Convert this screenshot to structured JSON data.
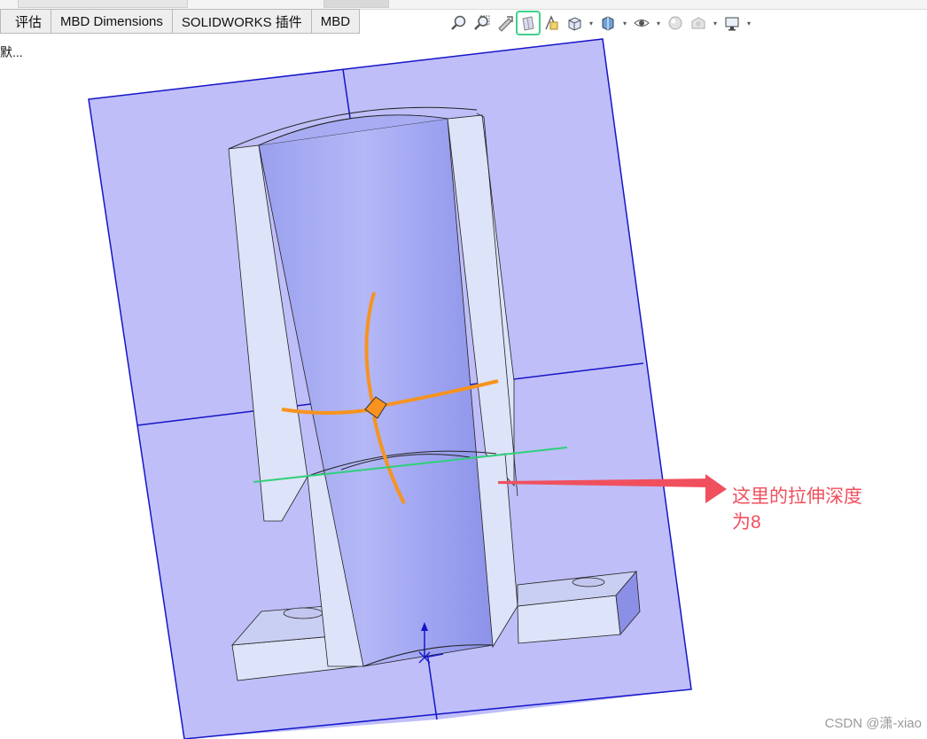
{
  "tabs": [
    {
      "label": "评估"
    },
    {
      "label": "MBD Dimensions"
    },
    {
      "label": "SOLIDWORKS 插件"
    },
    {
      "label": "MBD"
    }
  ],
  "view_toolbar": {
    "icons": [
      "zoom-to-fit-icon",
      "zoom-to-area-icon",
      "previous-view-icon",
      "section-view-icon",
      "dynamic-annotation-icon",
      "view-orientation-icon",
      "display-style-icon",
      "hide-show-items-icon",
      "edit-appearance-icon",
      "apply-scene-icon",
      "view-settings-icon"
    ],
    "active_icon": "section-view-icon"
  },
  "feature_tree": {
    "fragment": "默..."
  },
  "annotation": {
    "line1": "这里的拉伸深度",
    "line2": "为8"
  },
  "watermark": "CSDN @潇-xiao",
  "colors": {
    "section_plane": "#bfbef8",
    "plane_edge": "#1515c9",
    "model_face": "#dfe4f8",
    "cylinder": "#a3a8f3",
    "drag_arrows": "#f7931e",
    "green_line": "#2fd07a",
    "callout_arrow": "#f0505e"
  }
}
